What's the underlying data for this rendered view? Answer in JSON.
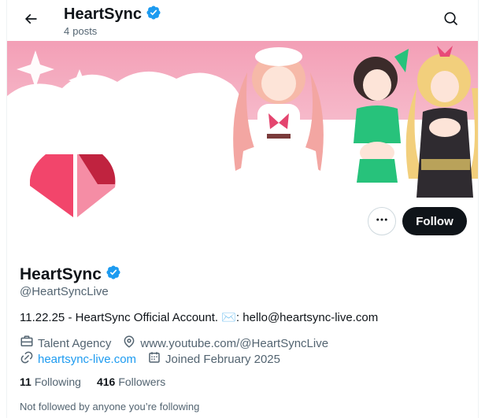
{
  "header": {
    "title": "HeartSync",
    "post_count": "4",
    "post_label": "posts"
  },
  "profile": {
    "display_name": "HeartSync",
    "handle": "@HeartSyncLive",
    "bio": "11.22.25 - HeartSync Official Account. ✉️: hello@heartsync-live.com",
    "category": "Talent Agency",
    "location": "www.youtube.com/@HeartSyncLive",
    "website": "heartsync-live.com",
    "joined": "Joined February 2025",
    "following_count": "11",
    "following_label": "Following",
    "followers_count": "416",
    "followers_label": "Followers",
    "not_followed_text": "Not followed by anyone you’re following"
  },
  "actions": {
    "follow_label": "Follow"
  },
  "icons": {
    "back": "arrow-left-icon",
    "verified": "verified-badge-icon",
    "search": "search-icon",
    "more": "more-horizontal-icon",
    "category": "briefcase-icon",
    "location": "location-pin-icon",
    "website": "link-icon",
    "joined": "calendar-icon"
  },
  "colors": {
    "accent": "#1d9bf0",
    "button_dark": "#0f1419",
    "text_secondary": "#536471",
    "brand_pink": "#f2456b",
    "brand_light_pink": "#f58da5",
    "brand_crimson": "#c0233f",
    "banner_bg": "#f7c7d6"
  }
}
